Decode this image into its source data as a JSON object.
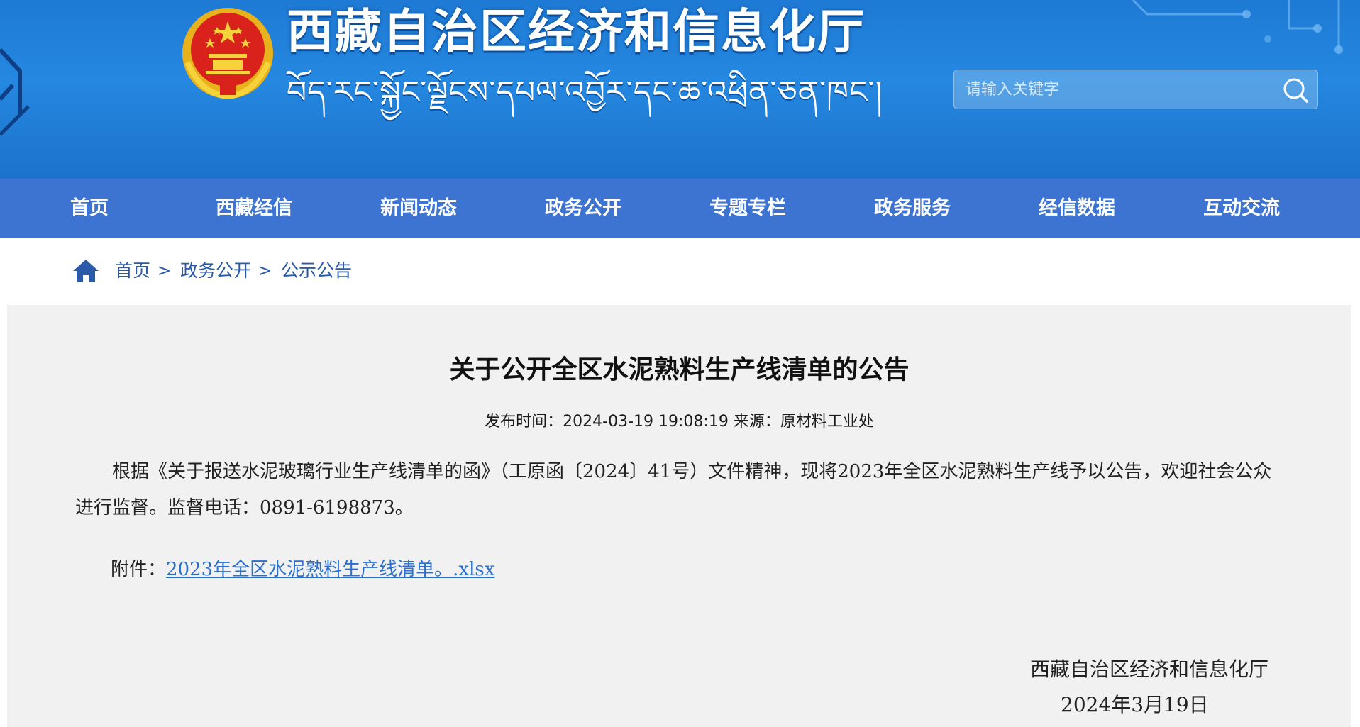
{
  "header": {
    "title_cn": "西藏自治区经济和信息化厅",
    "title_tibetan": "བོད་རང་སྐྱོང་ལྗོངས་དཔལ་འབྱོར་དང་ཆ་འཕྲིན་ཅན་ཁང་།",
    "search": {
      "placeholder": "请输入关键字",
      "value": "",
      "icon": "search-icon"
    },
    "emblem": "national-emblem",
    "colors": {
      "banner": "#2588e0",
      "nav": "#3d73d1"
    }
  },
  "nav": {
    "items": [
      {
        "label": "首页"
      },
      {
        "label": "西藏经信"
      },
      {
        "label": "新闻动态"
      },
      {
        "label": "政务公开"
      },
      {
        "label": "专题专栏"
      },
      {
        "label": "政务服务"
      },
      {
        "label": "经信数据"
      },
      {
        "label": "互动交流"
      }
    ]
  },
  "breadcrumb": {
    "icon": "home-icon",
    "items": [
      {
        "label": "首页"
      },
      {
        "label": "政务公开"
      },
      {
        "label": "公示公告"
      }
    ],
    "separator": ">"
  },
  "article": {
    "title": "关于公开全区水泥熟料生产线清单的公告",
    "meta": "发布时间：2024-03-19 19:08:19 来源：原材料工业处",
    "body": "根据《关于报送水泥玻璃行业生产线清单的函》（工原函〔2024〕41号）文件精神，现将2023年全区水泥熟料生产线予以公告，欢迎社会公众进行监督。监督电话：0891-6198873。",
    "attachment_label": "附件：",
    "attachment_link": "2023年全区水泥熟料生产线清单。.xlsx",
    "sign_org": "西藏自治区经济和信息化厅",
    "sign_date": "2024年3月19日"
  }
}
